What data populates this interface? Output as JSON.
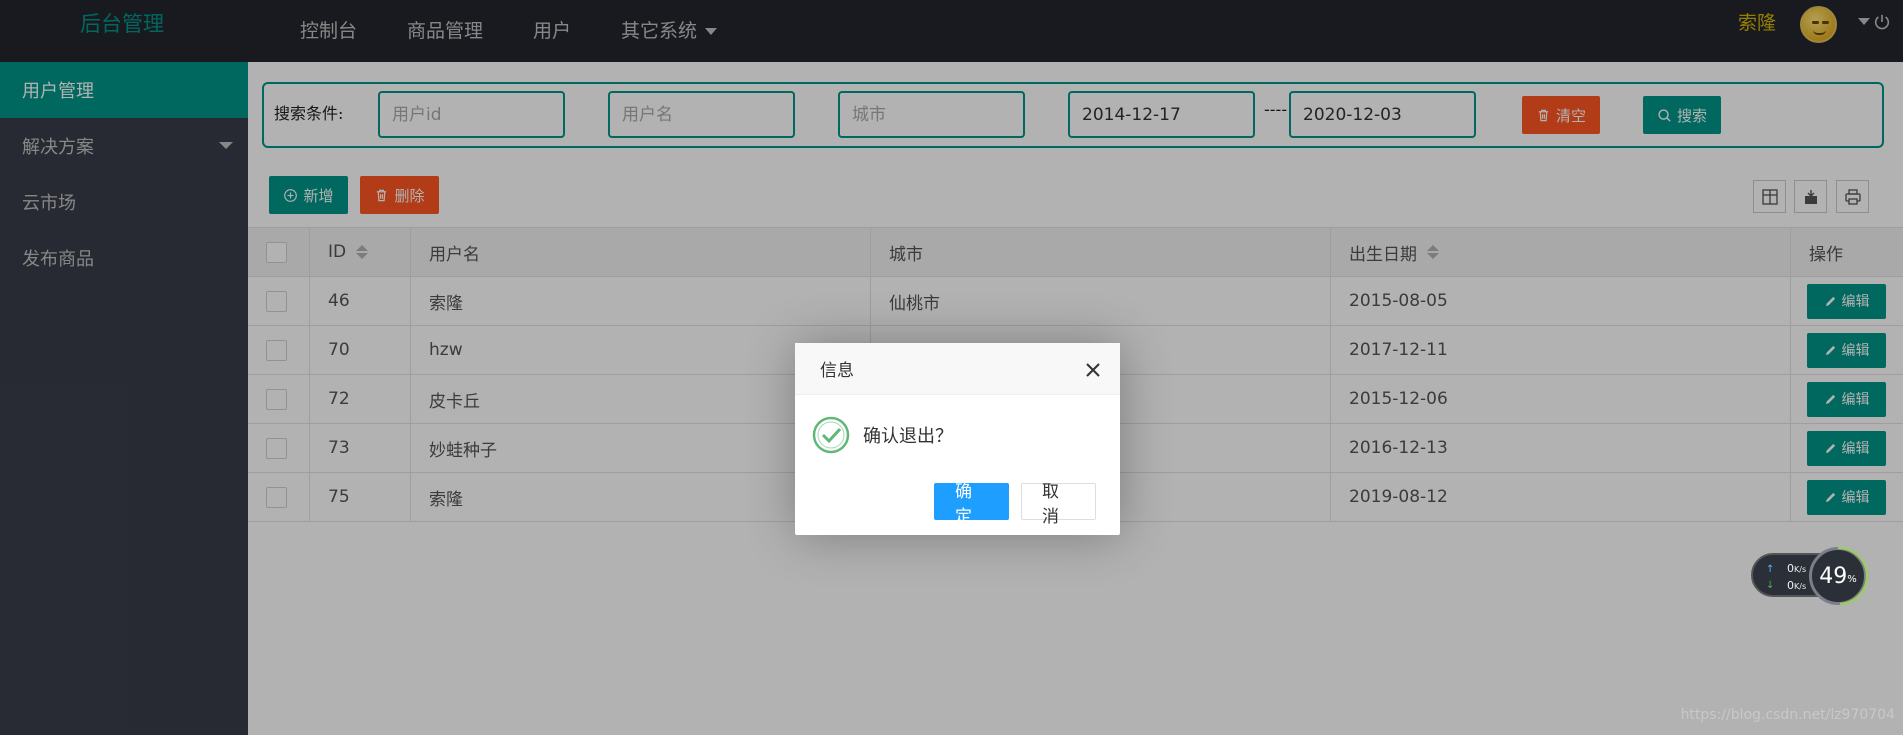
{
  "header": {
    "logo": "后台管理",
    "nav": [
      "控制台",
      "商品管理",
      "用户",
      "其它系统"
    ],
    "user_name": "索隆"
  },
  "sidebar": {
    "items": [
      {
        "label": "用户管理",
        "active": true
      },
      {
        "label": "解决方案",
        "has_submenu": true
      },
      {
        "label": "云市场"
      },
      {
        "label": "发布商品"
      }
    ]
  },
  "search": {
    "label": "搜索条件:",
    "user_id_placeholder": "用户id",
    "username_placeholder": "用户名",
    "city_placeholder": "城市",
    "date_from": "2014-12-17",
    "date_separator": "----",
    "date_to": "2020-12-03",
    "clear_label": "清空",
    "search_label": "搜索"
  },
  "toolbar": {
    "add_label": "新增",
    "delete_label": "删除"
  },
  "table": {
    "headers": [
      "ID",
      "用户名",
      "城市",
      "出生日期",
      "操作"
    ],
    "rows": [
      {
        "id": "46",
        "name": "索隆",
        "city": "仙桃市",
        "birth": "2015-08-05"
      },
      {
        "id": "70",
        "name": "hzw",
        "city": "",
        "birth": "2017-12-11"
      },
      {
        "id": "72",
        "name": "皮卡丘",
        "city": "",
        "birth": "2015-12-06"
      },
      {
        "id": "73",
        "name": "妙蛙种子",
        "city": "",
        "birth": "2016-12-13"
      },
      {
        "id": "75",
        "name": "索隆",
        "city": "",
        "birth": "2019-08-12"
      }
    ],
    "edit_label": "编辑"
  },
  "dialog": {
    "title": "信息",
    "message": "确认退出？",
    "ok_label": "确定",
    "cancel_label": "取消"
  },
  "net_widget": {
    "up": "0",
    "up_unit": "K/s",
    "down": "0",
    "down_unit": "K/s",
    "percent": "49",
    "percent_sign": "%"
  },
  "watermark": "https://blog.csdn.net/lz970704",
  "colors": {
    "brand": "#009688",
    "danger": "#ff5722",
    "dialog_ok": "#1e9fff",
    "topbar": "#23262e",
    "sidebar": "#393d49"
  }
}
